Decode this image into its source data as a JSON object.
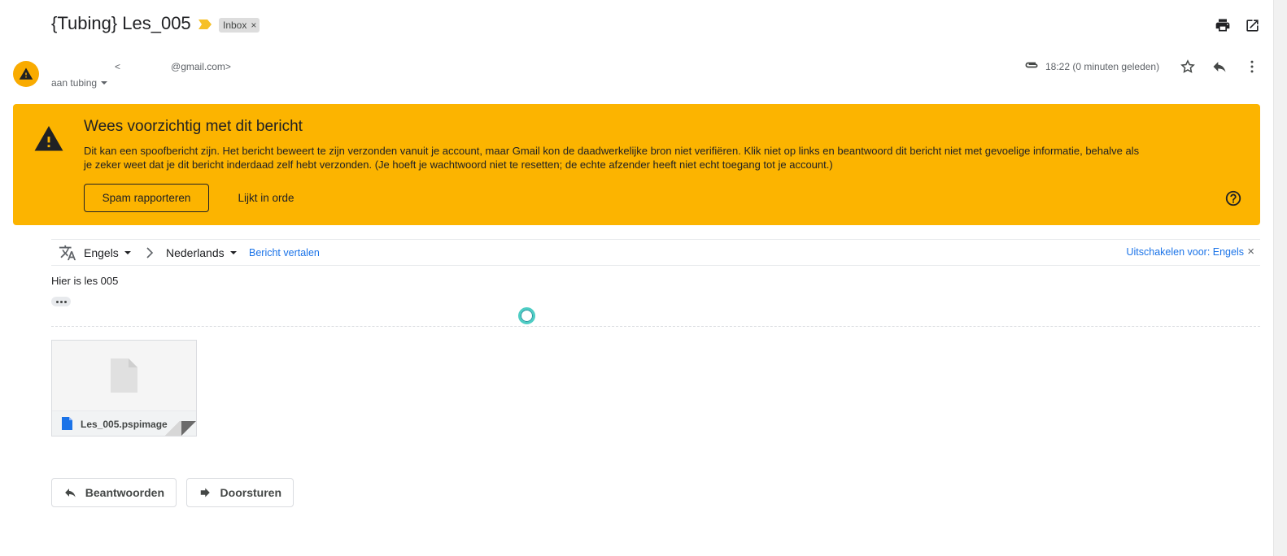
{
  "header": {
    "subject": "{Tubing} Les_005",
    "label_chip": "Inbox",
    "label_chip_close": "×",
    "important_marker_color": "#f6c026",
    "print_icon": "print-icon",
    "popout_icon": "open-in-new-window-icon"
  },
  "sender": {
    "email_left": "<",
    "email_domain": "@gmail.com>",
    "recipients": "aan tubing",
    "timestamp": "18:22 (0 minuten geleden)",
    "avatar_color": "#f9ab00"
  },
  "warning": {
    "title": "Wees voorzichtig met dit bericht",
    "body": "Dit kan een spoofbericht zijn. Het bericht beweert te zijn verzonden vanuit je account, maar Gmail kon de daadwerkelijke bron niet verifiëren. Klik niet op links en beantwoord dit bericht niet met gevoelige informatie, behalve als je zeker weet dat je dit bericht inderdaad zelf hebt verzonden. (Je hoeft je wachtwoord niet te resetten; de echte afzender heeft niet echt toegang tot je account.)",
    "report_button": "Spam rapporteren",
    "ok_button": "Lijkt in orde",
    "background_color": "#fcb400"
  },
  "translate": {
    "from_language": "Engels",
    "to_language": "Nederlands",
    "translate_link": "Bericht vertalen",
    "disable_link": "Uitschakelen voor: Engels",
    "close": "×"
  },
  "message": {
    "body": "Hier is les 005"
  },
  "attachment": {
    "filename": "Les_005.pspimage"
  },
  "actions": {
    "reply": "Beantwoorden",
    "forward": "Doorsturen"
  }
}
